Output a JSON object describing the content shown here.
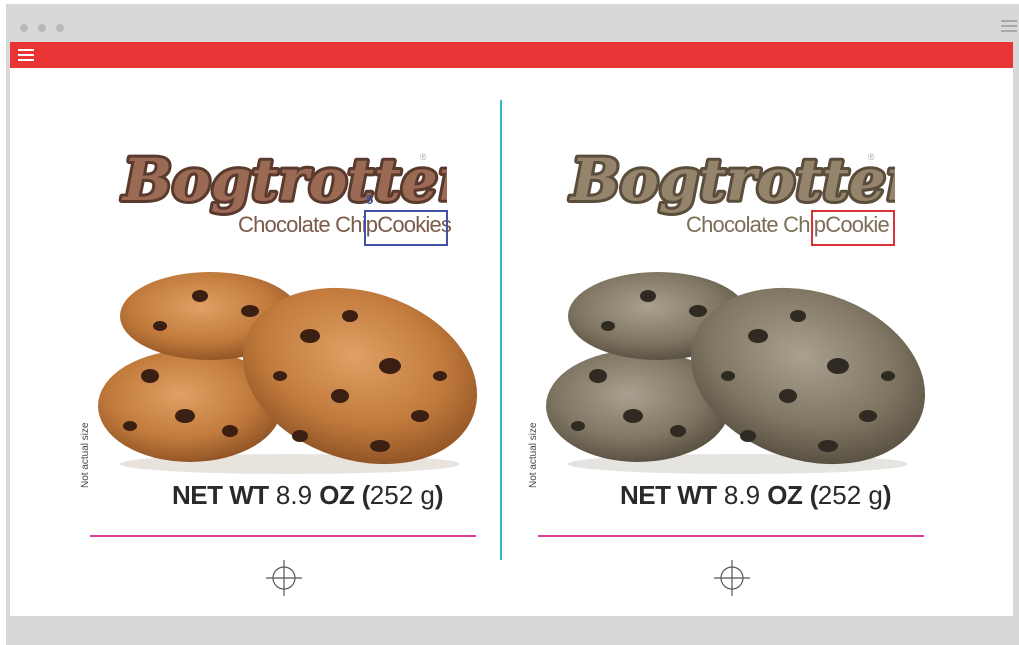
{
  "window": {
    "controls": [
      "dot",
      "dot",
      "dot"
    ],
    "menu_icon": "hamburger-icon"
  },
  "toolbar": {
    "menu_icon": "hamburger-icon",
    "accent_color": "#e83434"
  },
  "panels": [
    {
      "brand": "Bogtrotter",
      "reg": "®",
      "tagline_part1": "Chocolate Chip",
      "tagline_part2": "Cookies",
      "highlight_color": "#4450a6",
      "highlight_number": "5",
      "photo_tone": "color",
      "side_note": "Not actual size",
      "net_wt_label": "NET WT",
      "net_wt_value": "8.9",
      "net_wt_unit": "OZ",
      "net_wt_metric_open": "(",
      "net_wt_metric": "252 g",
      "net_wt_metric_close": ")"
    },
    {
      "brand": "Bogtrotter",
      "reg": "®",
      "tagline_part1": "Chocolate Chip",
      "tagline_part2": "Cookie",
      "highlight_color": "#d6333a",
      "photo_tone": "sepia",
      "side_note": "Not actual size",
      "net_wt_label": "NET WT",
      "net_wt_value": "8.9",
      "net_wt_unit": "OZ",
      "net_wt_metric_open": "(",
      "net_wt_metric": "252 g",
      "net_wt_metric_close": ")"
    }
  ],
  "colors": {
    "divider": "#35b6c6",
    "rule": "#d43e96"
  }
}
